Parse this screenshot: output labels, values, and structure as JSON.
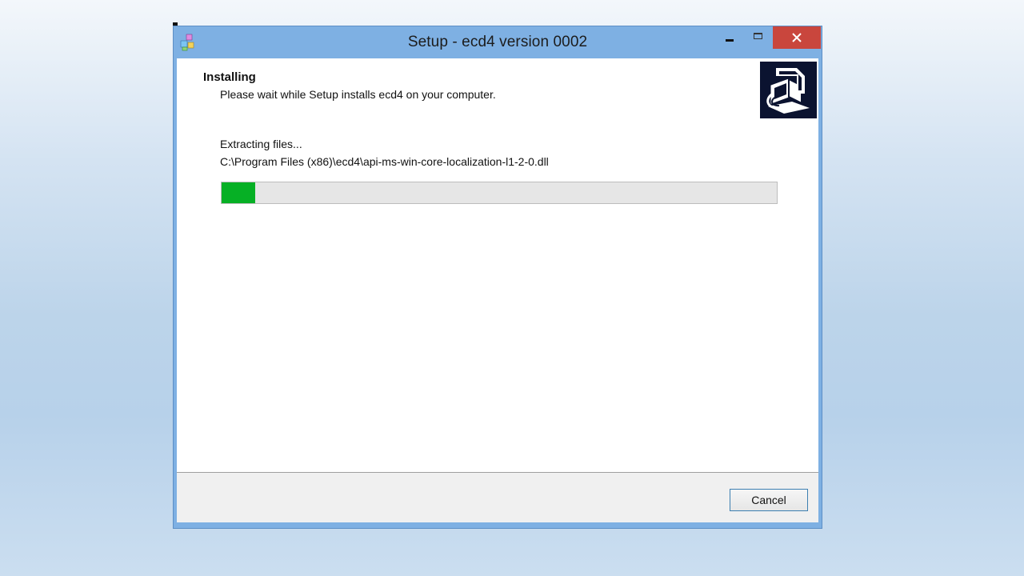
{
  "window": {
    "title": "Setup - ecd4 version 0002",
    "controls": {
      "minimize": "minimize",
      "maximize": "maximize",
      "close": "close"
    }
  },
  "page": {
    "heading": "Installing",
    "subheading": "Please wait while Setup installs ecd4 on your computer."
  },
  "progress": {
    "status": "Extracting files...",
    "current_file": "C:\\Program Files (x86)\\ecd4\\api-ms-win-core-localization-l1-2-0.dll",
    "percent": 6
  },
  "footer": {
    "cancel_label": "Cancel"
  },
  "icons": {
    "app": "installer-boxes-icon",
    "wizard_image": "computer-install-icon"
  },
  "colors": {
    "titlebar": "#7eb0e3",
    "close_button": "#c9463d",
    "progress_fill": "#06b025",
    "progress_track": "#e6e6e6"
  }
}
